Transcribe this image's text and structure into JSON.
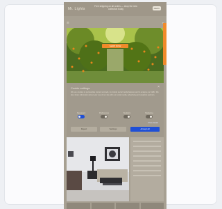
{
  "header": {
    "brand": "Mr. Lights",
    "promo": "Free shipping on all orders — shop the new collection today",
    "menu_label": "MENU"
  },
  "nav": {
    "left_icon": "☰",
    "right_icon": "⌕"
  },
  "hero": {
    "button_label": "SHOP NOW"
  },
  "consent": {
    "title": "Cookie settings",
    "close_icon": "×",
    "text": "We use cookies to personalise content and ads, to provide social media features and to analyse our traffic. We also share information about your use of our site with our social media, advertising and analytics partners.",
    "toggles": [
      {
        "label": "Necessary",
        "on": true
      },
      {
        "label": "Preferences",
        "on": false
      },
      {
        "label": "Statistics",
        "on": false
      },
      {
        "label": "Marketing",
        "on": false
      }
    ],
    "more_link": "Show details",
    "reject_label": "Reject",
    "settings_label": "Settings",
    "accept_label": "Accept all"
  },
  "colors": {
    "accent": "#f08a2a",
    "primary": "#1f4fd6",
    "overlay": "#a7a092"
  }
}
